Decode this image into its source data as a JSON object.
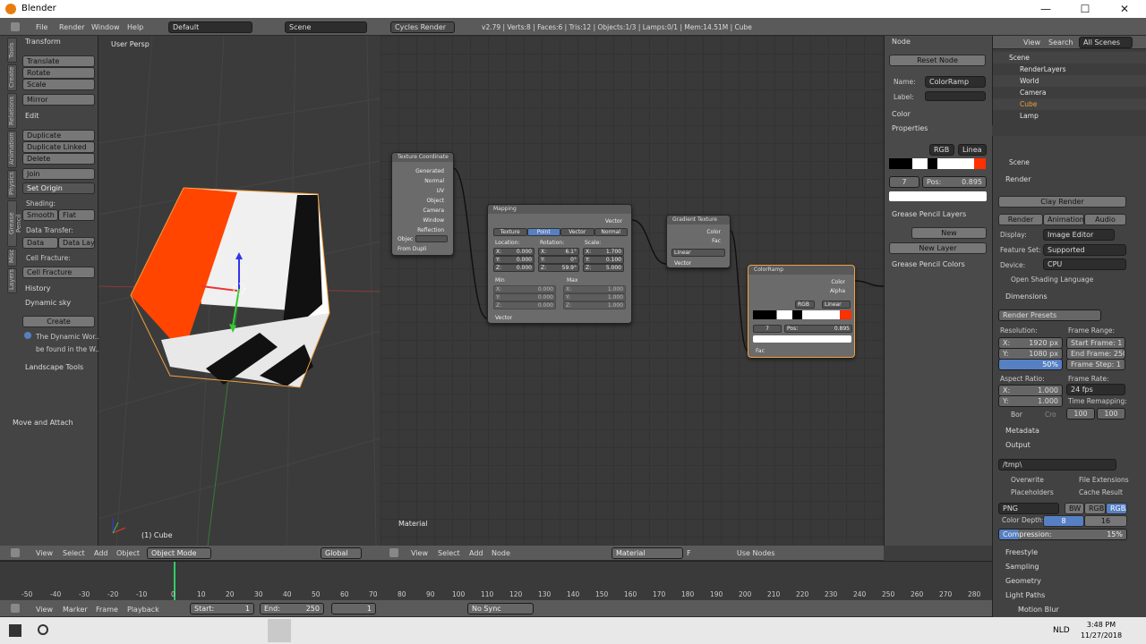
{
  "window": {
    "title": "Blender",
    "minimize": "—",
    "maximize": "☐",
    "close": "✕"
  },
  "topbar": {
    "menus": [
      "File",
      "Render",
      "Window",
      "Help"
    ],
    "layout": "Default",
    "scene": "Scene",
    "engine": "Cycles Render",
    "stats": "v2.79 | Verts:8 | Faces:6 | Tris:12 | Objects:1/3 | Lamps:0/1 | Mem:14.51M | Cube"
  },
  "tools": {
    "tabs": [
      "Tools",
      "Create",
      "Relations",
      "Animation",
      "Physics",
      "Grease Pencil",
      "Misc",
      "Layers"
    ],
    "transform": {
      "title": "Transform",
      "buttons": [
        "Translate",
        "Rotate",
        "Scale"
      ],
      "mirror": "Mirror"
    },
    "edit": {
      "title": "Edit",
      "buttons": [
        "Duplicate",
        "Duplicate Linked",
        "Delete"
      ],
      "join": "Join",
      "set_origin": "Set Origin",
      "shading": "Shading:",
      "smooth": "Smooth",
      "flat": "Flat",
      "data_transfer": "Data Transfer:",
      "data": "Data",
      "data_layo": "Data Layo",
      "cell_fracture": "Cell Fracture:",
      "cell_btn": "Cell Fracture"
    },
    "history": "History",
    "dynamic_sky": "Dynamic sky",
    "create": "Create",
    "info1": "The Dynamic Wor...",
    "info2": "be found in the W...",
    "landscape": "Landscape Tools",
    "move_attach": "Move and Attach"
  },
  "viewport": {
    "label": "User Persp",
    "object": "(1) Cube",
    "menus": [
      "View",
      "Select",
      "Add",
      "Object"
    ],
    "mode": "Object Mode",
    "orientation": "Global"
  },
  "node_editor": {
    "label": "Material",
    "menus": [
      "View",
      "Select",
      "Add",
      "Node"
    ],
    "material": "Material",
    "f": "F",
    "use_nodes": "Use Nodes",
    "texcoord": {
      "title": "Texture Coordinate",
      "outputs": [
        "Generated",
        "Normal",
        "UV",
        "Object",
        "Camera",
        "Window",
        "Reflection"
      ],
      "object": "Objec",
      "from_dupli": "From Dupli"
    },
    "mapping": {
      "title": "Mapping",
      "out": "Vector",
      "tabs": [
        "Texture",
        "Point",
        "Vector",
        "Normal"
      ],
      "location": "Location:",
      "rotation": "Rotation:",
      "scale": "Scale:",
      "loc": [
        "X:",
        "0.000",
        "Y:",
        "0.000",
        "Z:",
        "0.000"
      ],
      "rot": [
        "X:",
        "6.1°",
        "Y:",
        "0°",
        "Z:",
        "59.9°"
      ],
      "scl": [
        "X:",
        "1.700",
        "Y:",
        "0.100",
        "Z:",
        "5.000"
      ],
      "min": "Min",
      "max": "Max",
      "minv": [
        "X:",
        "0.000",
        "Y:",
        "0.000",
        "Z:",
        "0.000"
      ],
      "maxv": [
        "X:",
        "1.000",
        "Y:",
        "1.000",
        "Z:",
        "1.000"
      ],
      "in": "Vector"
    },
    "gradient": {
      "title": "Gradient Texture",
      "color": "Color",
      "fac": "Fac",
      "type": "Linear",
      "in": "Vector"
    },
    "ramp": {
      "title": "ColorRamp",
      "color": "Color",
      "alpha": "Alpha",
      "mode": "RGB",
      "interp": "Linear",
      "index": "7",
      "pos": "Pos:",
      "posv": "0.895",
      "fac": "Fac"
    }
  },
  "node_panel": {
    "node": "Node",
    "reset": "Reset Node",
    "name_lbl": "Name:",
    "name": "ColorRamp",
    "label_lbl": "Label:",
    "color": "Color",
    "properties": "Properties",
    "mode": "RGB",
    "interp": "Linea",
    "index": "7",
    "pos": "Pos:",
    "posv": "0.895",
    "gp_layers": "Grease Pencil Layers",
    "new": "New",
    "new_layer": "New Layer",
    "gp_colors": "Grease Pencil Colors"
  },
  "outliner": {
    "menus": [
      "View",
      "Search"
    ],
    "filter": "All Scenes",
    "items": [
      "Scene",
      "RenderLayers",
      "World",
      "Camera",
      "Cube",
      "Lamp"
    ]
  },
  "properties": {
    "scene": "Scene",
    "render": "Render",
    "clay": "Clay Render",
    "render_tab": "Render",
    "anim_tab": "Animation",
    "audio_tab": "Audio",
    "display_lbl": "Display:",
    "display": "Image Editor",
    "feature_lbl": "Feature Set:",
    "feature": "Supported",
    "device_lbl": "Device:",
    "device": "CPU",
    "osl": "Open Shading Language",
    "dimensions": "Dimensions",
    "presets": "Render Presets",
    "resolution": "Resolution:",
    "resx": "X:",
    "resxv": "1920 px",
    "resy": "Y:",
    "resyv": "1080 px",
    "pct": "50%",
    "frame_range": "Frame Range:",
    "start": "Start Frame: 1",
    "end": "End Frame: 250",
    "step": "Frame Step: 1",
    "aspect": "Aspect Ratio:",
    "ax": "X:",
    "axv": "1.000",
    "ay": "Y:",
    "ayv": "1.000",
    "frame_rate": "Frame Rate:",
    "fps": "24 fps",
    "time_remap": "Time Remapping:",
    "tr1": "100",
    "tr2": "100",
    "bor": "Bor",
    "cro": "Cro",
    "metadata": "Metadata",
    "output": "Output",
    "path": "/tmp\\",
    "overwrite": "Overwrite",
    "file_ext": "File Extensions",
    "placeholders": "Placeholders",
    "cache": "Cache Result",
    "format": "PNG",
    "bw": "BW",
    "rgb": "RGB",
    "rgba": "RGBA",
    "depth_lbl": "Color Depth:",
    "d8": "8",
    "d16": "16",
    "compression": "Compression:",
    "compv": "15%",
    "freestyle": "Freestyle",
    "sampling": "Sampling",
    "geometry": "Geometry",
    "light_paths": "Light Paths",
    "motion_blur": "Motion Blur"
  },
  "timeline": {
    "ticks": [
      "-50",
      "-40",
      "-30",
      "-20",
      "-10",
      "0",
      "10",
      "20",
      "30",
      "40",
      "50",
      "60",
      "70",
      "80",
      "90",
      "100",
      "110",
      "120",
      "130",
      "140",
      "150",
      "160",
      "170",
      "180",
      "190",
      "200",
      "210",
      "220",
      "230",
      "240",
      "250",
      "260",
      "270",
      "280"
    ],
    "menus": [
      "View",
      "Marker",
      "Frame",
      "Playback"
    ],
    "start": "Start:",
    "startv": "1",
    "end": "End:",
    "endv": "250",
    "frame": "1",
    "sync": "No Sync"
  },
  "taskbar": {
    "lang": "NLD",
    "time": "3:48 PM",
    "date": "11/27/2018"
  },
  "colors": {
    "orange": "#ff4500",
    "select": "#5680c2",
    "node_sel": "#f0a040"
  }
}
